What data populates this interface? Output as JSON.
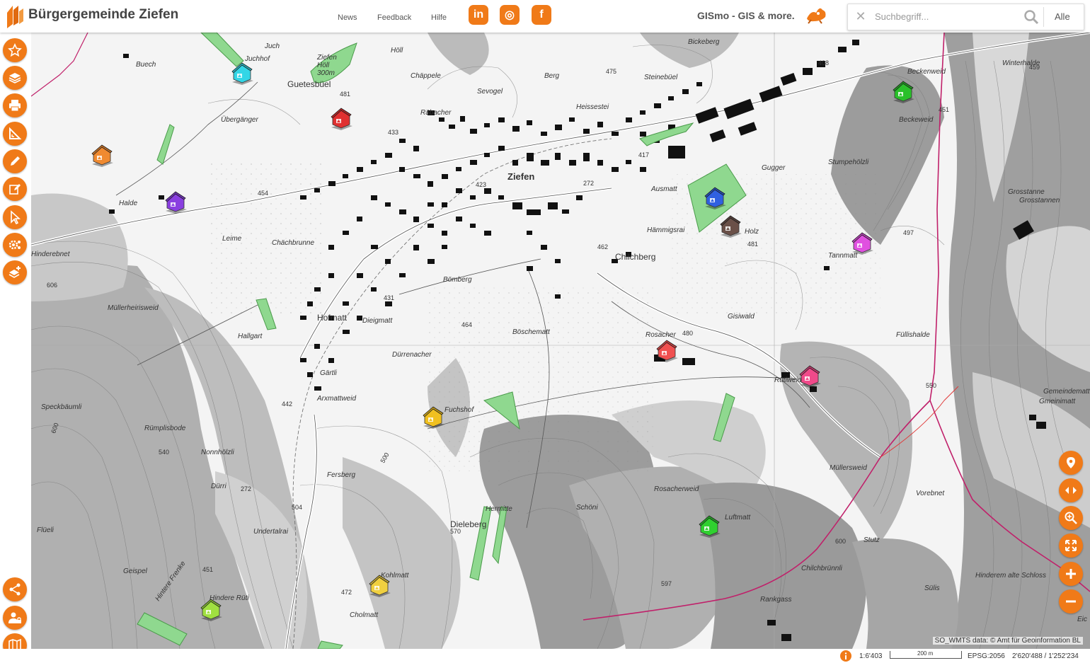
{
  "header": {
    "title": "Bürgergemeinde Ziefen",
    "nav": [
      "News",
      "Feedback",
      "Hilfe"
    ],
    "social": [
      {
        "name": "linkedin",
        "glyph": "in"
      },
      {
        "name": "instagram",
        "glyph": "◎"
      },
      {
        "name": "facebook",
        "glyph": "f"
      }
    ],
    "brand": "GISmo - GIS & more.",
    "search": {
      "placeholder": "Suchbegriff...",
      "filter": "Alle"
    }
  },
  "left_toolbar": [
    "star-icon",
    "layers-icon",
    "print-icon",
    "measure-icon",
    "draw-icon",
    "edit-icon",
    "select-icon",
    "settings-icon",
    "add-layer-icon"
  ],
  "left_toolbar_bottom": [
    "share-icon",
    "user-lock-icon",
    "map-icon"
  ],
  "right_toolbar": [
    "location-icon",
    "swipe-icon",
    "zoom-search-icon",
    "fullscreen-icon",
    "zoom-in-icon",
    "zoom-out-icon"
  ],
  "map": {
    "place_labels": [
      {
        "t": "Ziefen",
        "cls": "big"
      },
      {
        "t": "Chilchberg",
        "cls": "mid"
      },
      {
        "t": "Hofmatt",
        "cls": "mid"
      },
      {
        "t": "Dieleberg",
        "cls": "mid"
      },
      {
        "t": "Juchhof",
        "cls": ""
      },
      {
        "t": "Juch",
        "cls": ""
      },
      {
        "t": "Buech",
        "cls": ""
      },
      {
        "t": "Guetesbüel",
        "cls": "mid"
      },
      {
        "t": "Übergänger",
        "cls": ""
      },
      {
        "t": "Ziefen Höll 300m",
        "cls": ""
      },
      {
        "t": "Höll",
        "cls": ""
      },
      {
        "t": "Chäppele",
        "cls": ""
      },
      {
        "t": "Berg",
        "cls": ""
      },
      {
        "t": "Sevogel",
        "cls": ""
      },
      {
        "t": "Räbacher",
        "cls": ""
      },
      {
        "t": "Heissestei",
        "cls": ""
      },
      {
        "t": "Steinebüel",
        "cls": ""
      },
      {
        "t": "Bickeberg",
        "cls": ""
      },
      {
        "t": "Halde",
        "cls": ""
      },
      {
        "t": "Leime",
        "cls": ""
      },
      {
        "t": "Chächbrunne",
        "cls": ""
      },
      {
        "t": "Hinderebnet",
        "cls": ""
      },
      {
        "t": "Müllerheirisweid",
        "cls": ""
      },
      {
        "t": "Hallgart",
        "cls": ""
      },
      {
        "t": "Bömberg",
        "cls": ""
      },
      {
        "t": "Dieigmatt",
        "cls": ""
      },
      {
        "t": "Böschematt",
        "cls": ""
      },
      {
        "t": "Dürrenacher",
        "cls": ""
      },
      {
        "t": "Gärtli",
        "cls": ""
      },
      {
        "t": "Arxmattweid",
        "cls": ""
      },
      {
        "t": "Fuchshof",
        "cls": ""
      },
      {
        "t": "Speckbäumli",
        "cls": ""
      },
      {
        "t": "Rümplisbode",
        "cls": ""
      },
      {
        "t": "Nonnhölzli",
        "cls": ""
      },
      {
        "t": "Dürri",
        "cls": ""
      },
      {
        "t": "Fersberg",
        "cls": ""
      },
      {
        "t": "Undertalrai",
        "cls": ""
      },
      {
        "t": "Flüeli",
        "cls": ""
      },
      {
        "t": "Geispel",
        "cls": ""
      },
      {
        "t": "Hintere Frenke",
        "cls": ""
      },
      {
        "t": "Cholmatt",
        "cls": ""
      },
      {
        "t": "Kohlmatt",
        "cls": ""
      },
      {
        "t": "Hermitte",
        "cls": ""
      },
      {
        "t": "Schöni",
        "cls": ""
      },
      {
        "t": "Rosacherweid",
        "cls": ""
      },
      {
        "t": "Luftmatt",
        "cls": ""
      },
      {
        "t": "Rosacher",
        "cls": ""
      },
      {
        "t": "Gisiwald",
        "cls": ""
      },
      {
        "t": "Ausmatt",
        "cls": ""
      },
      {
        "t": "Hämmigsrai",
        "cls": ""
      },
      {
        "t": "Holz",
        "cls": ""
      },
      {
        "t": "Gugger",
        "cls": ""
      },
      {
        "t": "Stumpehölzli",
        "cls": ""
      },
      {
        "t": "Tannmatt",
        "cls": ""
      },
      {
        "t": "Beckenweid",
        "cls": ""
      },
      {
        "t": "Beckeweid",
        "cls": ""
      },
      {
        "t": "Winterhalde",
        "cls": ""
      },
      {
        "t": "Grosstanne",
        "cls": ""
      },
      {
        "t": "Grosstannen",
        "cls": ""
      },
      {
        "t": "Füllishalde",
        "cls": ""
      },
      {
        "t": "Rütiweid",
        "cls": ""
      },
      {
        "t": "Gemeindematt",
        "cls": ""
      },
      {
        "t": "Gmeinimatt",
        "cls": ""
      },
      {
        "t": "Müllersweid",
        "cls": ""
      },
      {
        "t": "Vorebnet",
        "cls": ""
      },
      {
        "t": "Stutz",
        "cls": ""
      },
      {
        "t": "Chilchbrünnli",
        "cls": ""
      },
      {
        "t": "Sülis",
        "cls": ""
      },
      {
        "t": "Hinderem alte Schloss",
        "cls": ""
      },
      {
        "t": "Rankgass",
        "cls": ""
      },
      {
        "t": "Eic",
        "cls": ""
      },
      {
        "t": "Hindere Rüti",
        "cls": ""
      },
      {
        "t": "Hintere Frenke",
        "cls": ""
      }
    ],
    "spot_heights": [
      "475",
      "408",
      "459",
      "451",
      "417",
      "433",
      "481",
      "454",
      "423",
      "462",
      "481",
      "497",
      "606",
      "480",
      "464",
      "431",
      "550",
      "442",
      "540",
      "504",
      "570",
      "451",
      "472",
      "597",
      "600",
      "500",
      "600",
      "272",
      "272"
    ],
    "markers": [
      {
        "name": "juchhof",
        "color": "#33d6e6"
      },
      {
        "name": "guetesbuel",
        "color": "#e03030"
      },
      {
        "name": "west-orange",
        "color": "#f08a30"
      },
      {
        "name": "halde",
        "color": "#8a3fe0"
      },
      {
        "name": "ausmatt",
        "color": "#3060e0"
      },
      {
        "name": "holz",
        "color": "#6a5048"
      },
      {
        "name": "tannmatt",
        "color": "#e050e0"
      },
      {
        "name": "beckenweid",
        "color": "#2ac02a"
      },
      {
        "name": "rosacher",
        "color": "#f05050"
      },
      {
        "name": "rutiweid",
        "color": "#f04a8a"
      },
      {
        "name": "fuchshof",
        "color": "#f0c020"
      },
      {
        "name": "luftmatt",
        "color": "#30d030"
      },
      {
        "name": "kohlmatt",
        "color": "#f0d040"
      },
      {
        "name": "hindere-ruti",
        "color": "#a0e040"
      }
    ]
  },
  "footer": {
    "scale": "1:6'403",
    "scalebar": "200 m",
    "crs": "EPSG:2056",
    "coords": "2'620'488 / 1'252'234",
    "attribution": "SO_WMTS data: © Amt für Geoinformation BL"
  },
  "colors": {
    "accent": "#f07a18",
    "forest_patch": "#7fcf7f",
    "boundary": "#c0206a"
  }
}
